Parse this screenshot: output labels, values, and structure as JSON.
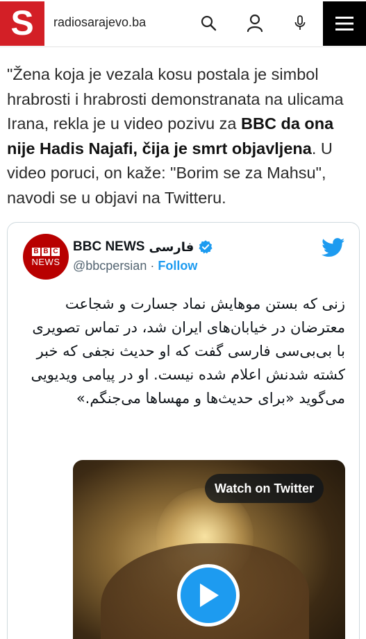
{
  "header": {
    "logo_letter": "S",
    "site_name": "radiosarajevo.ba",
    "icons": [
      "search-icon",
      "user-icon",
      "microphone-icon",
      "menu-icon"
    ],
    "brand_color": "#d31f26"
  },
  "article": {
    "paragraph": {
      "part1": "\"Žena koja je vezala kosu postala je simbol hrabrosti i hrabrosti demonstranata na ulicama Irana, rekla je u video pozivu za ",
      "bold": "BBC da ona nije Hadis Najafi, čija je smrt objavljena",
      "part2": ". U video poruci, on kaže: \"Borim se za Mahsu\", navodi se u objavi na Twitteru."
    }
  },
  "tweet": {
    "avatar": {
      "top": "BBC",
      "bottom": "NEWS"
    },
    "name": "BBC NEWS",
    "name_persian": "فارسی",
    "handle": "@bbcpersian",
    "separator": "·",
    "follow_label": "Follow",
    "text": "زنی که بستن موهایش نماد جسارت و شجاعت معترضان در خیابان‌های ایران شد، در تماس تصویری با بی‌بی‌سی فارسی گفت که او حدیث نجفی که خبر کشته شدنش اعلام شده نیست. او در پیامی ویدیویی می‌گوید «برای حدیث‌ها و مهساها می‌جنگم.»",
    "video": {
      "watch_label": "Watch on Twitter"
    },
    "accent_color": "#1d9bf0"
  }
}
